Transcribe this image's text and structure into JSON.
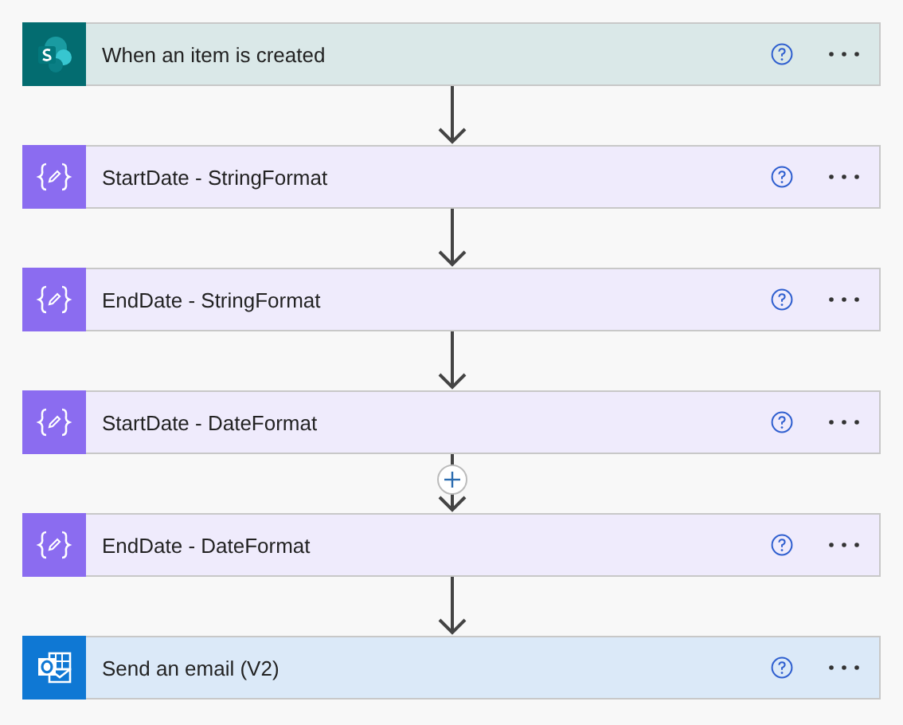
{
  "steps": [
    {
      "kind": "sharepoint",
      "title": "When an item is created"
    },
    {
      "kind": "compose",
      "title": "StartDate - StringFormat"
    },
    {
      "kind": "compose",
      "title": "EndDate - StringFormat"
    },
    {
      "kind": "compose",
      "title": "StartDate - DateFormat"
    },
    {
      "kind": "compose",
      "title": "EndDate - DateFormat"
    },
    {
      "kind": "outlook",
      "title": "Send an email (V2)"
    }
  ],
  "connectors": [
    {
      "insert_button_shown": false
    },
    {
      "insert_button_shown": false
    },
    {
      "insert_button_shown": false
    },
    {
      "insert_button_shown": true
    },
    {
      "insert_button_shown": false
    }
  ]
}
